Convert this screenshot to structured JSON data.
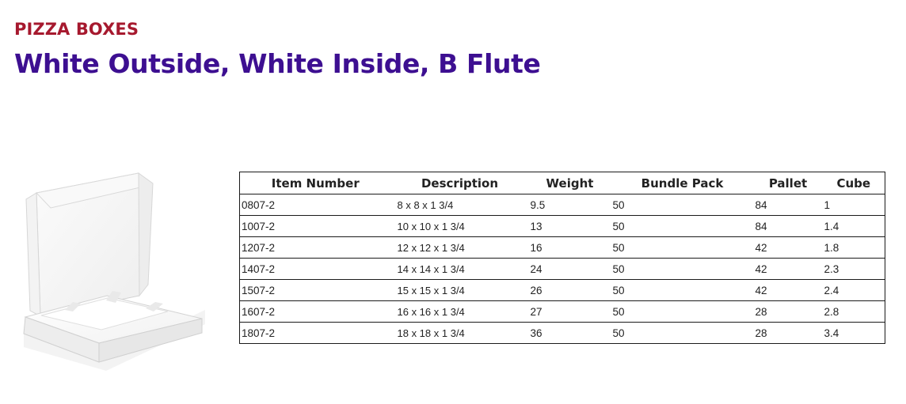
{
  "header": {
    "eyebrow": "PIZZA BOXES",
    "title": "White Outside, White Inside, B Flute"
  },
  "product_image": {
    "icon": "pizza-box-image",
    "colors": {
      "outer": "#f3f3f3",
      "inner": "#ffffff",
      "edge": "#d9d9d9",
      "shadow": "#bfbfbf"
    }
  },
  "table": {
    "headers": [
      "Item Number",
      "Description",
      "Weight",
      "Bundle Pack",
      "Pallet",
      "Cube"
    ],
    "rows": [
      [
        "0807-2",
        "8 x 8 x 1 3/4",
        "9.5",
        "50",
        "84",
        "1"
      ],
      [
        "1007-2",
        "10 x 10 x 1 3/4",
        "13",
        "50",
        "84",
        "1.4"
      ],
      [
        "1207-2",
        "12 x 12 x 1 3/4",
        "16",
        "50",
        "42",
        "1.8"
      ],
      [
        "1407-2",
        "14 x 14 x 1 3/4",
        "24",
        "50",
        "42",
        "2.3"
      ],
      [
        "1507-2",
        "15 x 15 x 1 3/4",
        "26",
        "50",
        "42",
        "2.4"
      ],
      [
        "1607-2",
        "16 x 16 x 1 3/4",
        "27",
        "50",
        "28",
        "2.8"
      ],
      [
        "1807-2",
        "18 x 18 x 1 3/4",
        "36",
        "50",
        "28",
        "3.4"
      ]
    ]
  }
}
